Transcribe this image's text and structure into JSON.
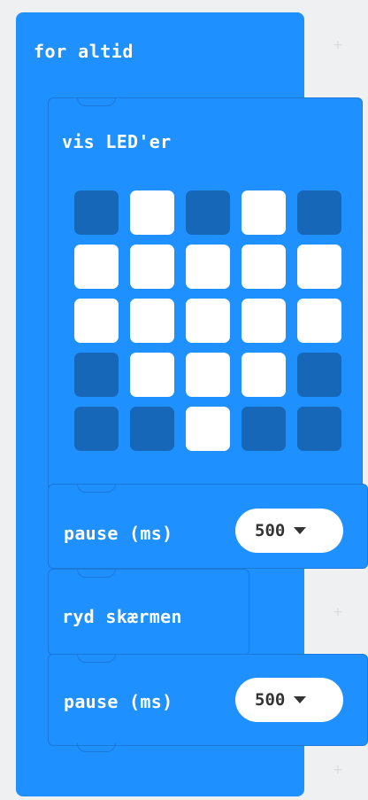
{
  "colors": {
    "block": "#1e90ff",
    "block_border": "#1b79d8",
    "led_off": "#1767b8",
    "led_on": "#ffffff",
    "workspace": "#eef0f2"
  },
  "forever_block": {
    "label": "for altid"
  },
  "show_leds_block": {
    "label": "vis LED'er",
    "leds": [
      [
        0,
        1,
        0,
        1,
        0
      ],
      [
        1,
        1,
        1,
        1,
        1
      ],
      [
        1,
        1,
        1,
        1,
        1
      ],
      [
        0,
        1,
        1,
        1,
        0
      ],
      [
        0,
        0,
        1,
        0,
        0
      ]
    ]
  },
  "pause_block_1": {
    "label": "pause (ms)",
    "value": "500",
    "icon": "chevron-down-icon"
  },
  "clear_screen_block": {
    "label": "ryd skærmen"
  },
  "pause_block_2": {
    "label": "pause (ms)",
    "value": "500",
    "icon": "chevron-down-icon"
  }
}
